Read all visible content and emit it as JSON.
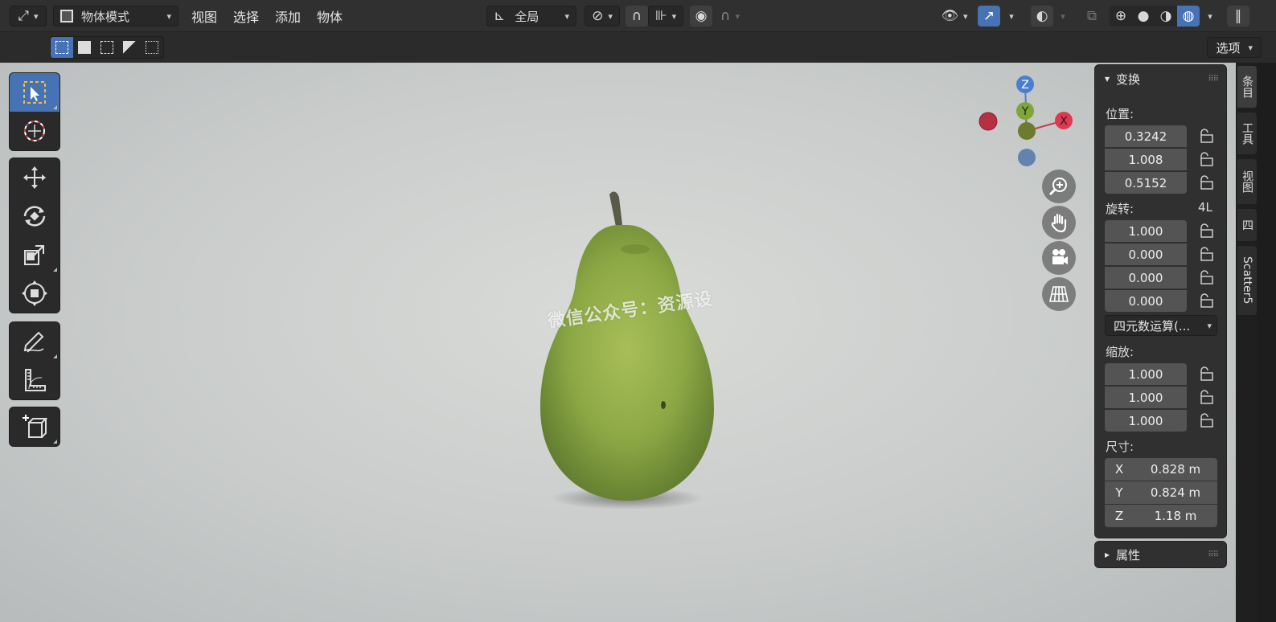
{
  "header": {
    "mode_label": "物体模式",
    "menus": [
      "视图",
      "选择",
      "添加",
      "物体"
    ],
    "transform_orientation": "全局"
  },
  "toolbar2": {
    "options_label": "选项"
  },
  "viewport": {
    "watermark": "微信公众号：资源设",
    "gizmo": {
      "z": "Z",
      "y": "Y",
      "x": "X"
    }
  },
  "npanel": {
    "transform_title": "变换",
    "location_label": "位置:",
    "location": [
      "0.3242",
      "1.008",
      "0.5152"
    ],
    "rotation_label": "旋转:",
    "rotation_mode_badge": "4L",
    "rotation": [
      "1.000",
      "0.000",
      "0.000",
      "0.000"
    ],
    "rotation_mode": "四元数运算(...",
    "scale_label": "缩放:",
    "scale": [
      "1.000",
      "1.000",
      "1.000"
    ],
    "dimensions_label": "尺寸:",
    "dimensions": [
      {
        "axis": "X",
        "value": "0.828 m"
      },
      {
        "axis": "Y",
        "value": "0.824 m"
      },
      {
        "axis": "Z",
        "value": "1.18 m"
      }
    ],
    "properties_title": "属性"
  },
  "side_tabs": [
    "条目",
    "工具",
    "视图",
    "四",
    "Scatter5"
  ]
}
